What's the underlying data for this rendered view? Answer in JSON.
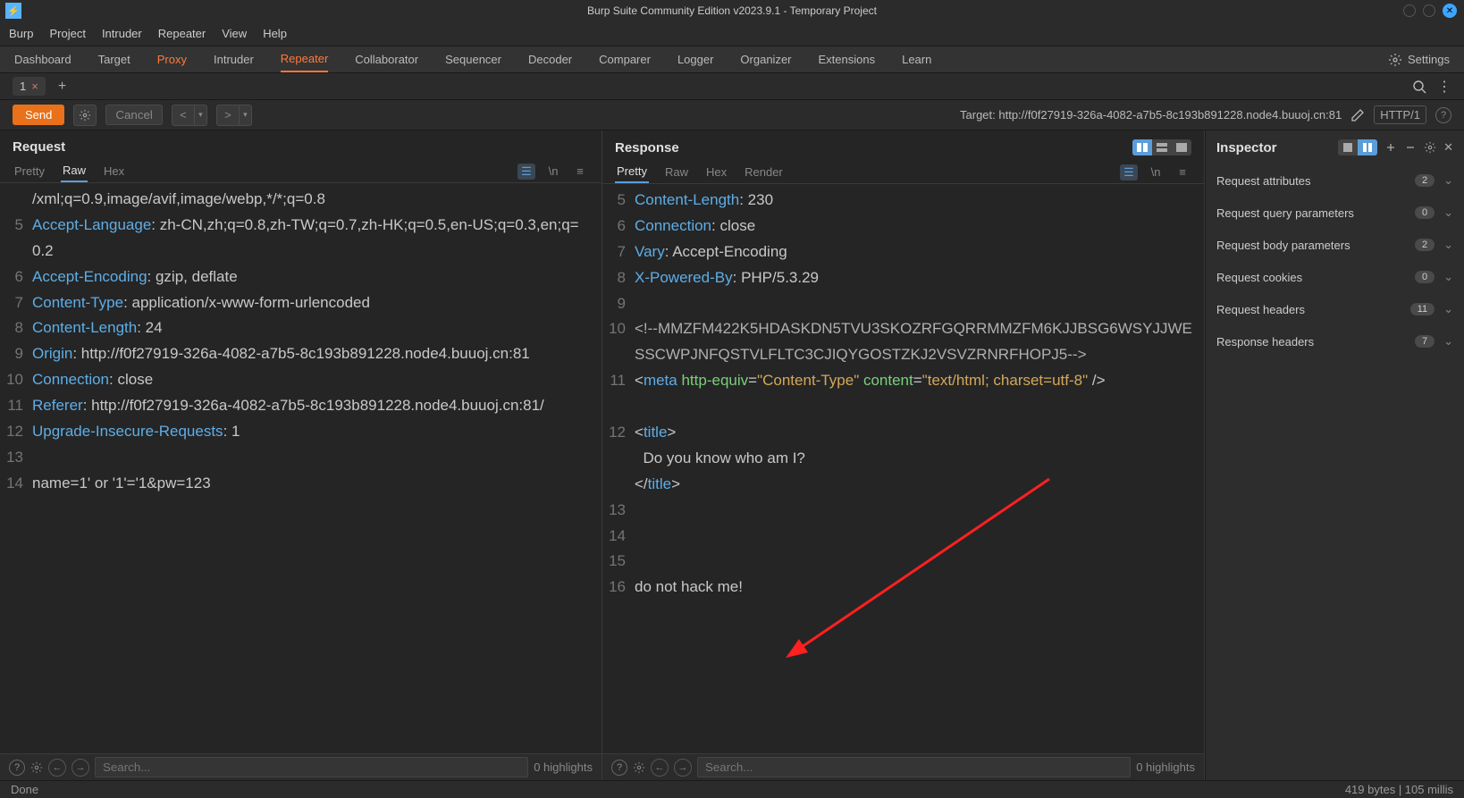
{
  "titlebar": {
    "title": "Burp Suite Community Edition v2023.9.1 - Temporary Project"
  },
  "menu": [
    "Burp",
    "Project",
    "Intruder",
    "Repeater",
    "View",
    "Help"
  ],
  "maintabs": {
    "items": [
      "Dashboard",
      "Target",
      "Proxy",
      "Intruder",
      "Repeater",
      "Collaborator",
      "Sequencer",
      "Decoder",
      "Comparer",
      "Logger",
      "Organizer",
      "Extensions",
      "Learn"
    ],
    "active": "Repeater",
    "orange_set": [
      "Proxy",
      "Repeater"
    ],
    "settings_label": "Settings"
  },
  "subtabs": {
    "active_label": "1",
    "close_glyph": "×"
  },
  "actionbar": {
    "send": "Send",
    "cancel": "Cancel",
    "target_prefix": "Target: ",
    "target_url": "http://f0f27919-326a-4082-a7b5-8c193b891228.node4.buuoj.cn:81",
    "http_badge": "HTTP/1"
  },
  "request": {
    "title": "Request",
    "tabs": [
      "Pretty",
      "Raw",
      "Hex"
    ],
    "active_tab": "Raw",
    "search_placeholder": "Search...",
    "highlights": "0 highlights",
    "lines_visible": [
      {
        "n": "",
        "raw": "/xml;q=0.9,image/avif,image/webp,*/*;q=0.8"
      },
      {
        "n": "5",
        "raw": "Accept-Language: zh-CN,zh;q=0.8,zh-TW;q=0.7,zh-HK;q=0.5,en-US;q=0.3,en;q=0.2",
        "hname": "Accept-Language",
        "hval": "zh-CN,zh;q=0.8,zh-TW;q=0.7,zh-HK;q=0.5,en-US;q=0.3,en;q=0.2"
      },
      {
        "n": "6",
        "raw": "Accept-Encoding: gzip, deflate",
        "hname": "Accept-Encoding",
        "hval": "gzip, deflate"
      },
      {
        "n": "7",
        "raw": "Content-Type: application/x-www-form-urlencoded",
        "hname": "Content-Type",
        "hval": "application/x-www-form-urlencoded"
      },
      {
        "n": "8",
        "raw": "Content-Length: 24",
        "hname": "Content-Length",
        "hval": "24"
      },
      {
        "n": "9",
        "raw": "Origin: http://f0f27919-326a-4082-a7b5-8c193b891228.node4.buuoj.cn:81",
        "hname": "Origin",
        "hval": "http://f0f27919-326a-4082-a7b5-8c193b891228.node4.buuoj.cn:81"
      },
      {
        "n": "10",
        "raw": "Connection: close",
        "hname": "Connection",
        "hval": "close"
      },
      {
        "n": "11",
        "raw": "Referer: http://f0f27919-326a-4082-a7b5-8c193b891228.node4.buuoj.cn:81/",
        "hname": "Referer",
        "hval": "http://f0f27919-326a-4082-a7b5-8c193b891228.node4.buuoj.cn:81/"
      },
      {
        "n": "12",
        "raw": "Upgrade-Insecure-Requests: 1",
        "hname": "Upgrade-Insecure-Requests",
        "hval": "1"
      },
      {
        "n": "13",
        "raw": ""
      },
      {
        "n": "14",
        "raw": "name=1' or '1'='1&pw=123"
      }
    ]
  },
  "response": {
    "title": "Response",
    "tabs": [
      "Pretty",
      "Raw",
      "Hex",
      "Render"
    ],
    "active_tab": "Pretty",
    "search_placeholder": "Search...",
    "highlights": "0 highlights",
    "lines": {
      "l5": {
        "hname": "Content-Length",
        "hval": "230"
      },
      "l6": {
        "hname": "Connection",
        "hval": "close"
      },
      "l7": {
        "hname": "Vary",
        "hval": "Accept-Encoding"
      },
      "l8": {
        "hname": "X-Powered-By",
        "hval": "PHP/5.3.29"
      },
      "l10_comment": "<!--MMZFM422K5HDASKDN5TVU3SKOZRFGQRRMMZFM6KJJBSG6WSYJJWESSCWPJNFQSTVLFLTC3CJIQYGOSTZKJ2VSVZRNRFHOPJ5-->",
      "l11_meta_tag": "meta",
      "l11_attr": "http-equiv",
      "l11_val": "Content-Type",
      "l11_attr2": "content",
      "l11_val2": "text/html; charset=utf-8",
      "l12_open": "title",
      "l12_text": "Do you know who am I?",
      "l12_close": "title",
      "l16": "do not hack me!"
    }
  },
  "inspector": {
    "title": "Inspector",
    "rows": [
      {
        "label": "Request attributes",
        "count": "2"
      },
      {
        "label": "Request query parameters",
        "count": "0"
      },
      {
        "label": "Request body parameters",
        "count": "2"
      },
      {
        "label": "Request cookies",
        "count": "0"
      },
      {
        "label": "Request headers",
        "count": "11"
      },
      {
        "label": "Response headers",
        "count": "7"
      }
    ]
  },
  "statusbar": {
    "left": "Done",
    "right": "419 bytes | 105 millis"
  }
}
